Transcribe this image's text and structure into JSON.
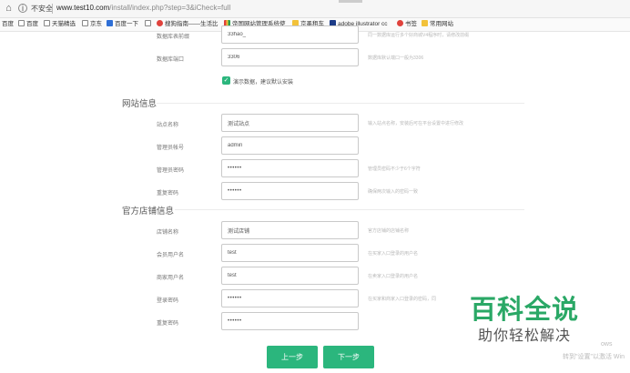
{
  "browser": {
    "insecure_label": "不安全",
    "url_host": "www.test10.com",
    "url_path": "/install/index.php?step=3&iCheck=full",
    "bookmarks": [
      "百度",
      "百度",
      "天猫精选",
      "京东",
      "百度一下",
      "",
      "搜狗指南——生活比",
      "帝国网站管理系统使",
      "京墨租车",
      "adobe illustrator cc",
      "书签",
      "常用网站"
    ]
  },
  "db": {
    "prefix_label": "数据库表前缀",
    "prefix_value": "33hao_",
    "prefix_hint": "同一数据库运行多个好商城V4程序时，请修改前缀",
    "port_label": "数据库端口",
    "port_value": "3306",
    "port_hint": "数据库默认端口一般为3306",
    "demo_checkbox_label": "演示数据，建议默认安装"
  },
  "site": {
    "section_title": "网站信息",
    "name_label": "站点名称",
    "name_value": "测试站点",
    "name_hint": "输入站点名称，安装后可在平台设置中进行修改",
    "admin_label": "管理员帐号",
    "admin_value": "admin",
    "password_label": "管理员密码",
    "password_value": "••••••",
    "password_hint": "管理员密码不少于6个字符",
    "repeat_label": "重复密码",
    "repeat_value": "••••••",
    "repeat_hint": "确保两次输入的密码一致"
  },
  "store": {
    "section_title": "官方店铺信息",
    "name_label": "店铺名称",
    "name_value": "测试店铺",
    "name_hint": "官方店铺的店铺名称",
    "member_label": "会员用户名",
    "member_value": "test",
    "member_hint": "在买家入口登录的用户名",
    "seller_label": "商家用户名",
    "seller_value": "test",
    "seller_hint": "在卖家入口登录的用户名",
    "login_pw_label": "登录密码",
    "login_pw_value": "••••••",
    "login_pw_hint": "在买家和商家入口登录的密码，同",
    "repeat_label": "重复密码",
    "repeat_value": "••••••"
  },
  "buttons": {
    "prev": "上一步",
    "next": "下一步"
  },
  "watermark": {
    "title": "百科全说",
    "subtitle": "助你轻松解决"
  },
  "windows_activation": {
    "line1": "ows",
    "line2": "转到\"设置\"以激活 Win"
  },
  "colors": {
    "accent": "#2bb67d",
    "watermark_green": "#2aa866"
  }
}
